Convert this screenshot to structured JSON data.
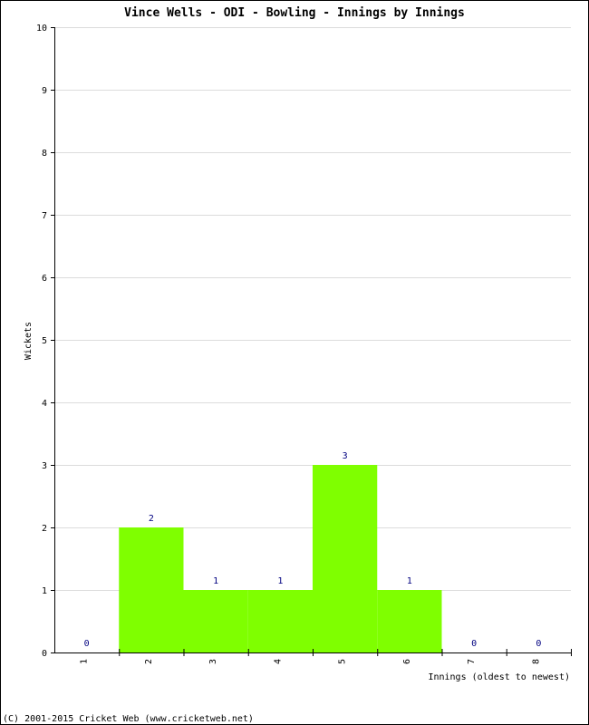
{
  "chart_data": {
    "type": "bar",
    "title": "Vince Wells - ODI - Bowling - Innings by Innings",
    "xlabel": "Innings (oldest to newest)",
    "ylabel": "Wickets",
    "categories": [
      "1",
      "2",
      "3",
      "4",
      "5",
      "6",
      "7",
      "8"
    ],
    "values": [
      0,
      2,
      1,
      1,
      3,
      1,
      0,
      0
    ],
    "ylim": [
      0,
      10
    ],
    "yticks": [
      0,
      1,
      2,
      3,
      4,
      5,
      6,
      7,
      8,
      9,
      10
    ],
    "grid": true,
    "bar_color": "#7fff00",
    "label_color": "#000080"
  },
  "footer": "(C) 2001-2015 Cricket Web (www.cricketweb.net)"
}
